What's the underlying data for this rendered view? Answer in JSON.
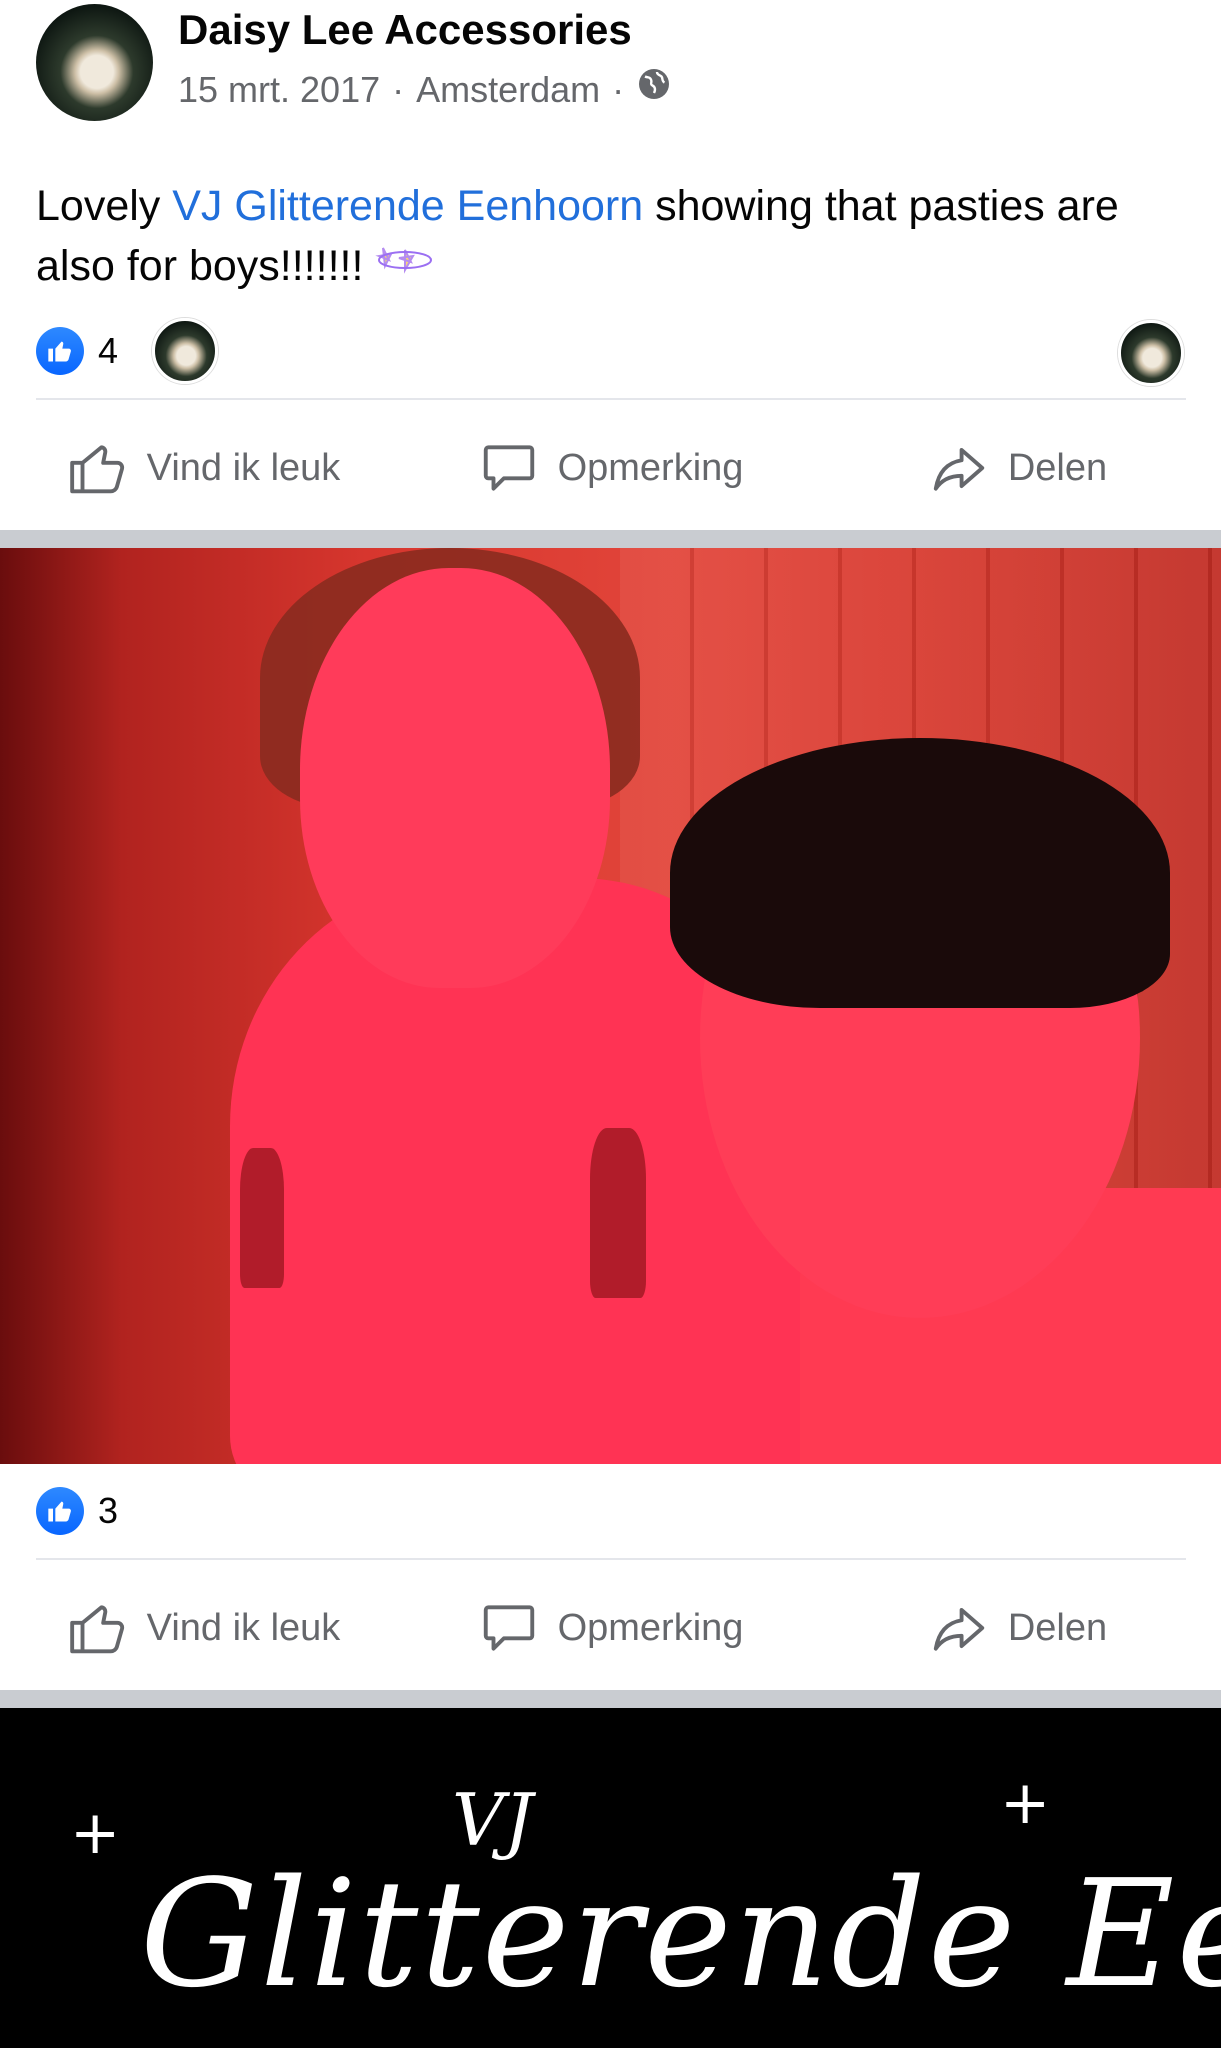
{
  "post": {
    "page_name": "Daisy Lee Accessories",
    "date": "15 mrt. 2017",
    "location": "Amsterdam",
    "sep": "·",
    "text_before": "Lovely ",
    "mention": "VJ Glitterende Eenhoorn",
    "text_after": " showing that pasties are also for boys!!!!!!!"
  },
  "reactions_1": {
    "count": "4"
  },
  "reactions_2": {
    "count": "3"
  },
  "actions": {
    "like": "Vind ik leuk",
    "comment": "Opmerking",
    "share": "Delen"
  },
  "banner": {
    "vj": "VJ",
    "title": "Glitterende Eenhoorn"
  },
  "icons": {
    "globe": "globe-icon",
    "like": "thumbs-up-icon",
    "comment": "speech-bubble-icon",
    "share": "share-arrow-icon",
    "sparkles": "sparkles-emoji"
  },
  "colors": {
    "accent": "#216fdb",
    "like_blue": "#0866ff",
    "muted": "#65676b"
  }
}
